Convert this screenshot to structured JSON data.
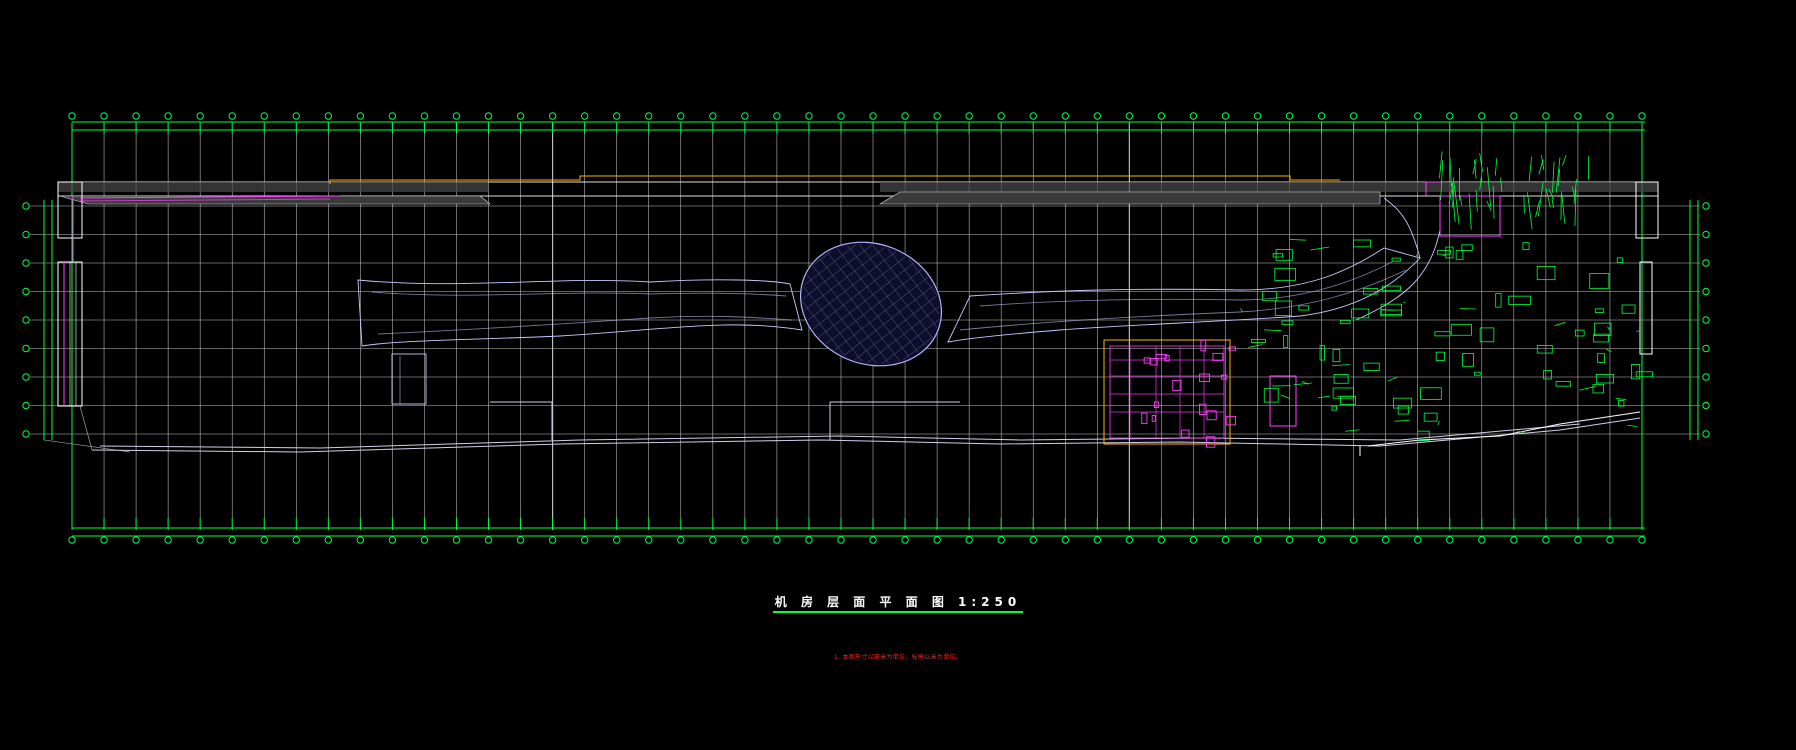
{
  "drawing": {
    "title": "机 房 层 面 平 面 图 1:250",
    "note": "1. 本图尺寸以毫米为单位，标高以米为单位。"
  },
  "colors": {
    "background": "#000000",
    "grid": "#c8c8c8",
    "axis": "#00ff3c",
    "outline": "#d0d0e8",
    "equipment": "#00ff3c",
    "pipe": "#ff40ff",
    "roof_line": "#ffb400",
    "dome": "#b4b4ff",
    "note": "#ff2020"
  },
  "grid": {
    "column_count": 50,
    "row_count": 9
  }
}
